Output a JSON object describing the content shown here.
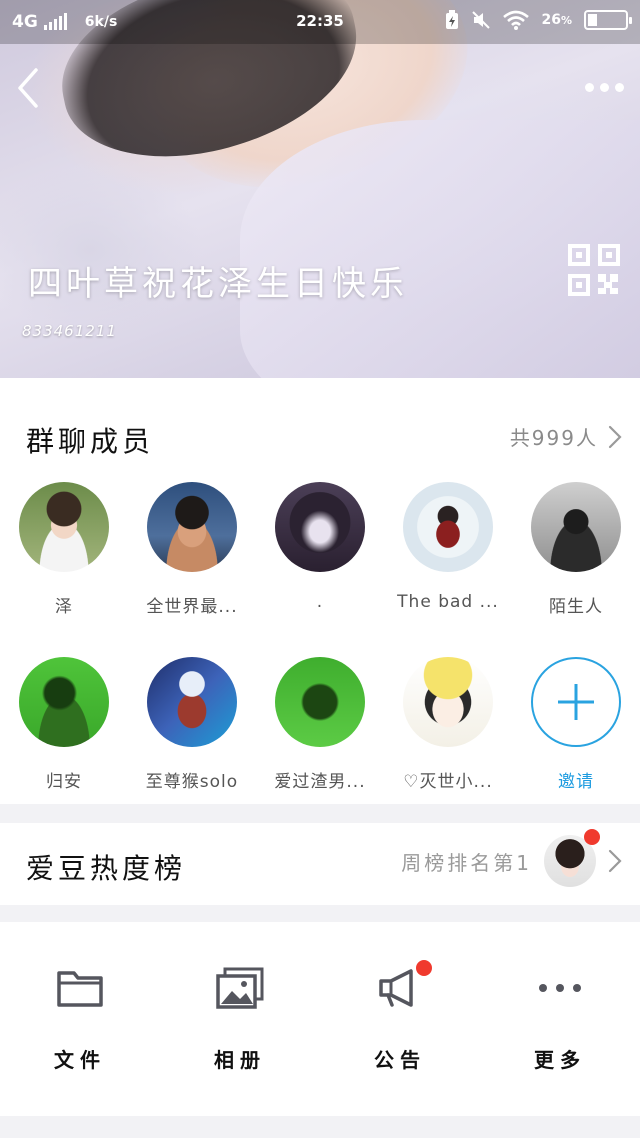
{
  "status_bar": {
    "network": "4G",
    "speed": "6k/s",
    "time": "22:35",
    "battery": "26"
  },
  "header": {
    "group_name": "四叶草祝花泽生日快乐",
    "group_id": "833461211"
  },
  "members_section": {
    "title": "群聊成员",
    "count_label": "共999人",
    "members": [
      {
        "name": "泽"
      },
      {
        "name": "全世界最..."
      },
      {
        "name": "."
      },
      {
        "name": "The  bad  ..."
      },
      {
        "name": "陌生人"
      },
      {
        "name": "归安"
      },
      {
        "name": "至尊猴solo"
      },
      {
        "name": "爱过渣男..."
      },
      {
        "name": "♡灭世小..."
      }
    ],
    "invite_label": "邀请"
  },
  "ranking": {
    "title": "爱豆热度榜",
    "week_rank": "周榜排名第1"
  },
  "toolbar": {
    "items": [
      {
        "label": "文件",
        "icon": "folder-icon"
      },
      {
        "label": "相册",
        "icon": "album-icon"
      },
      {
        "label": "公告",
        "icon": "megaphone-icon"
      },
      {
        "label": "更多",
        "icon": "more-dots-icon"
      }
    ]
  },
  "colors": {
    "accent": "#1c9be0",
    "badge": "#f03a2e",
    "icon_gray": "#55565e"
  }
}
